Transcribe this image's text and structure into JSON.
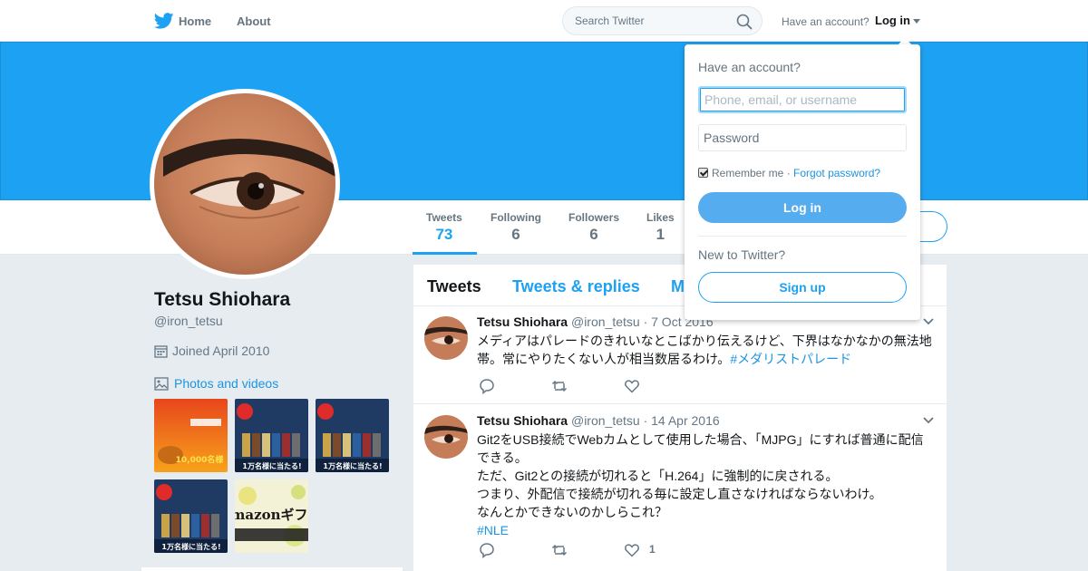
{
  "nav": {
    "home_label": "Home",
    "about_label": "About",
    "search_placeholder": "Search Twitter",
    "have_account": "Have an account?",
    "login_label": "Log in"
  },
  "colors": {
    "accent": "#1da1f2",
    "banner": "#1da1f2",
    "link": "#1b95e0",
    "page_bg": "#e6ecf0"
  },
  "profile": {
    "name": "Tetsu Shiohara",
    "handle": "@iron_tetsu",
    "joined": "Joined April 2010",
    "photos_link": "Photos and videos"
  },
  "stats": [
    {
      "label": "Tweets",
      "value": "73"
    },
    {
      "label": "Following",
      "value": "6"
    },
    {
      "label": "Followers",
      "value": "6"
    },
    {
      "label": "Likes",
      "value": "1"
    }
  ],
  "timeline": {
    "tabs": [
      "Tweets",
      "Tweets & replies",
      "M"
    ]
  },
  "tweets": [
    {
      "name": "Tetsu Shiohara",
      "handle": "@iron_tetsu",
      "date": "· 7 Oct 2016",
      "lines": [
        "メディアはパレードのきれいなとこばかり伝えるけど、下界はなかなかの無法地",
        "帯。常にやりたくない人が相当数居るわけ。"
      ],
      "hashtag": "#メダリストパレード",
      "like_count": ""
    },
    {
      "name": "Tetsu Shiohara",
      "handle": "@iron_tetsu",
      "date": "· 14 Apr 2016",
      "lines": [
        "Git2をUSB接続でWebカムとして使用した場合、「MJPG」にすれば普通に配信",
        "できる。",
        "ただ、Git2との接続が切れると「H.264」に強制的に戻される。",
        "つまり、外配信で接続が切れる毎に設定し直さなければならないわけ。",
        "なんとかできないのかしらこれ？"
      ],
      "hashtag": "#NLE",
      "like_count": "1"
    }
  ],
  "login_dropdown": {
    "title": "Have an account?",
    "username_placeholder": "Phone, email, or username",
    "password_placeholder": "Password",
    "remember_label": "Remember me",
    "separator": "·",
    "forgot_label": "Forgot password?",
    "login_button": "Log in",
    "new_label": "New to Twitter?",
    "signup_button": "Sign up"
  },
  "photo_thumbnails": [
    {
      "icon": "thumbnail-tea-ad",
      "text": "10,000名様"
    },
    {
      "icon": "thumbnail-coffee-set",
      "text": "1万名様に当たる!"
    },
    {
      "icon": "thumbnail-coffee-set",
      "text": "1万名様に当たる!"
    },
    {
      "icon": "thumbnail-coffee-set",
      "text": "1万名様に当たる!"
    },
    {
      "icon": "thumbnail-amazon-gift",
      "text": "mazonギフ"
    }
  ]
}
